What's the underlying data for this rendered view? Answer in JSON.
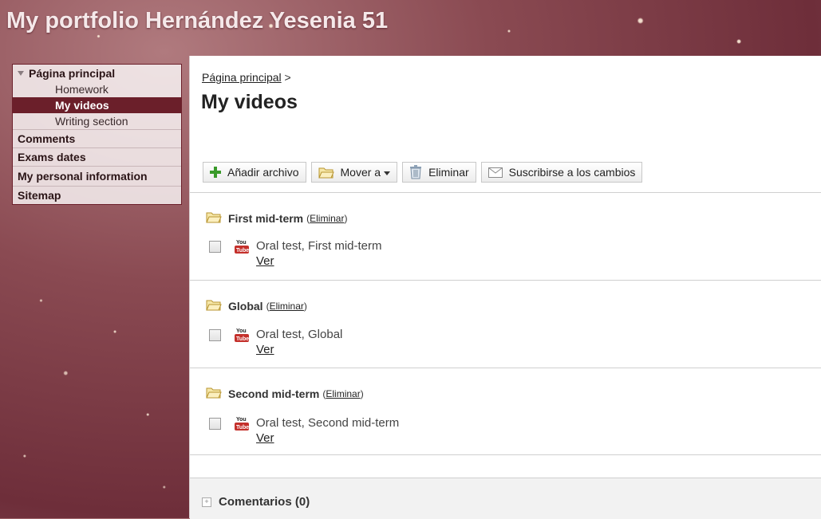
{
  "site": {
    "title": "My portfolio Hernández Yesenia 51"
  },
  "sidebar": {
    "root_label": "Página principal",
    "sub_items": [
      "Homework",
      "My videos",
      "Writing section"
    ],
    "active_sub": "My videos",
    "items": [
      "Comments",
      "Exams dates",
      "My personal information",
      "Sitemap"
    ]
  },
  "breadcrumb": {
    "link": "Página principal",
    "separator": ">"
  },
  "page": {
    "title": "My videos"
  },
  "toolbar": {
    "add_file": "Añadir archivo",
    "move_to": "Mover a",
    "delete": "Eliminar",
    "subscribe": "Suscribirse a los cambios"
  },
  "folders": [
    {
      "name": "First mid-term",
      "delete_label": "Eliminar",
      "file": "Oral test, First mid-term",
      "view_label": "Ver"
    },
    {
      "name": "Global",
      "delete_label": "Eliminar",
      "file": "Oral test, Global",
      "view_label": "Ver"
    },
    {
      "name": "Second mid-term",
      "delete_label": "Eliminar",
      "file": "Oral test, Second mid-term",
      "view_label": "Ver"
    }
  ],
  "comments": {
    "label": "Comentarios (0)"
  },
  "icons": {
    "file_type": "youtube-icon",
    "folder": "folder-icon",
    "add": "plus-icon",
    "trash": "trash-icon",
    "mail": "envelope-icon"
  },
  "colors": {
    "accent": "#6b1f2a",
    "add_green": "#3a9a2a"
  }
}
